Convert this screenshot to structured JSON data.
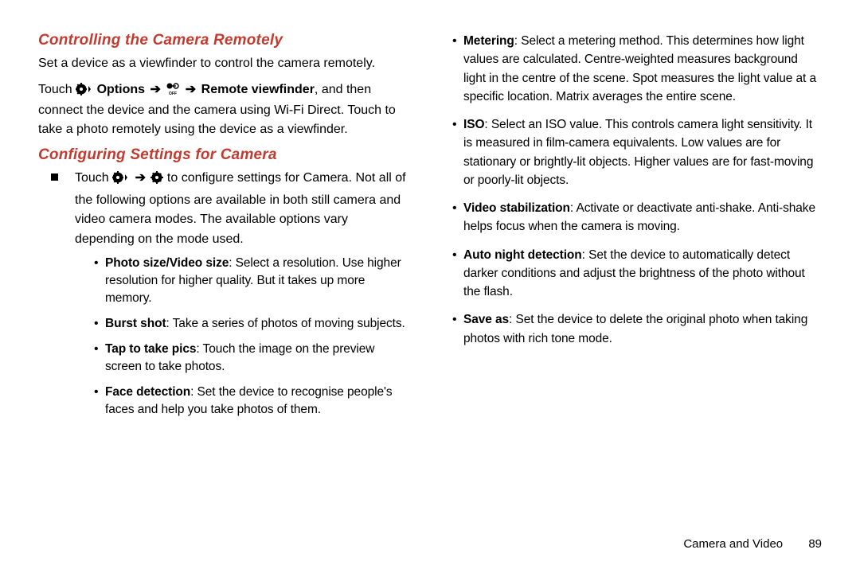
{
  "section1_title": "Controlling the Camera Remotely",
  "section1_para1": "Set a device as a viewfinder to control the camera remotely.",
  "section1_para2a": "Touch ",
  "section1_options": "Options",
  "section1_remote": "Remote viewfinder",
  "section1_para2b": ", and then connect the device and the camera using Wi-Fi Direct. Touch to take a photo remotely using the device as a viewfinder.",
  "section2_title": "Configuring Settings for Camera",
  "section2_intro_a": "Touch ",
  "section2_intro_b": " to configure settings for Camera. Not all of the following options are available in both still camera and video camera modes. The available options vary depending on the mode used.",
  "items_left": [
    {
      "label": "Photo size/Video size",
      "text": ": Select a resolution. Use higher resolution for higher quality. But it takes up more memory."
    },
    {
      "label": "Burst shot",
      "text": ": Take a series of photos of moving subjects."
    },
    {
      "label": "Tap to take pics",
      "text": ": Touch the image on the preview screen to take photos."
    },
    {
      "label": "Face detection",
      "text": ": Set the device to recognise people's faces and help you take photos of them."
    }
  ],
  "items_right": [
    {
      "label": "Metering",
      "text": ": Select a metering method. This determines how light values are calculated. Centre-weighted measures background light in the centre of the scene. Spot measures the light value at a specific location. Matrix averages the entire scene."
    },
    {
      "label": "ISO",
      "text": ": Select an ISO value. This controls camera light sensitivity. It is measured in film-camera equivalents. Low values are for stationary or brightly-lit objects. Higher values are for fast-moving or poorly-lit objects."
    },
    {
      "label": "Video stabilization",
      "text": ": Activate or deactivate anti-shake. Anti-shake helps focus when the camera is moving."
    },
    {
      "label": "Auto night detection",
      "text": ": Set the device to automatically detect darker conditions and adjust the brightness of the photo without the flash."
    },
    {
      "label": "Save as",
      "text": ": Set the device to delete the original photo when taking photos with rich tone mode."
    }
  ],
  "footer_chapter": "Camera and Video",
  "footer_page": "89"
}
